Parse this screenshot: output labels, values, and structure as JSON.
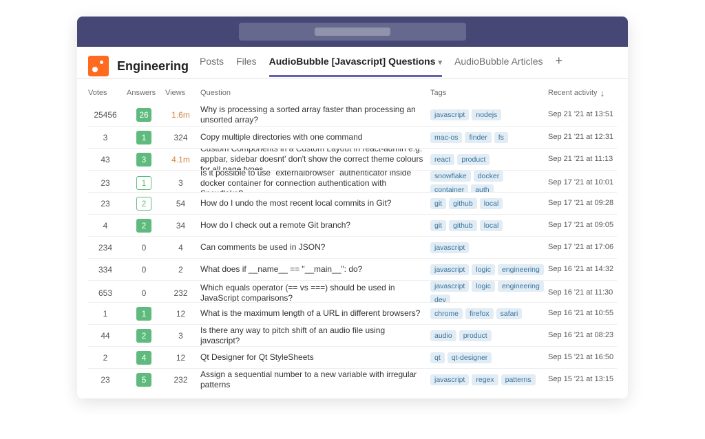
{
  "teamName": "Engineering",
  "tabs": [
    {
      "label": "Posts",
      "active": false,
      "key": "posts"
    },
    {
      "label": "Files",
      "active": false,
      "key": "files"
    },
    {
      "label": "AudioBubble [Javascript] Questions",
      "active": true,
      "hasChevron": true,
      "key": "questions"
    },
    {
      "label": "AudioBubble Articles",
      "active": false,
      "key": "articles"
    }
  ],
  "columns": {
    "votes": "Votes",
    "answers": "Answers",
    "views": "Views",
    "question": "Question",
    "tags": "Tags",
    "activity": "Recent activity"
  },
  "rows": [
    {
      "votes": "25456",
      "answers": "26",
      "answerStyle": "filled",
      "views": "1.6m",
      "viewsBig": true,
      "question": "Why is processing a sorted array faster than processing an unsorted array?",
      "tags": [
        "javascript",
        "nodejs"
      ],
      "activity": "Sep 21 '21 at 13:51"
    },
    {
      "votes": "3",
      "answers": "1",
      "answerStyle": "filled",
      "views": "324",
      "viewsBig": false,
      "question": "Copy multiple directories with one command",
      "tags": [
        "mac-os",
        "finder",
        "fs"
      ],
      "activity": "Sep 21 '21 at 12:31"
    },
    {
      "votes": "43",
      "answers": "3",
      "answerStyle": "filled",
      "views": "4.1m",
      "viewsBig": true,
      "question": "Custom Components in a Custom Layout in react-admin e.g. appbar, sidebar doesnt' don't show the correct theme colours for all page types",
      "tags": [
        "react",
        "product"
      ],
      "activity": "Sep 21 '21 at 11:13"
    },
    {
      "votes": "23",
      "answers": "1",
      "answerStyle": "outlined",
      "views": "3",
      "viewsBig": false,
      "question": "Is it possible to use `externalbrowser` authenticator inside docker container for connection authentication with Snowflake?",
      "tags": [
        "snowflake",
        "docker",
        "container",
        "auth"
      ],
      "activity": "Sep 17 '21 at 10:01"
    },
    {
      "votes": "23",
      "answers": "2",
      "answerStyle": "outlined",
      "views": "54",
      "viewsBig": false,
      "question": "How do I undo the most recent local commits in Git?",
      "tags": [
        "git",
        "github",
        "local"
      ],
      "activity": "Sep 17 '21 at 09:28"
    },
    {
      "votes": "4",
      "answers": "2",
      "answerStyle": "filled",
      "views": "34",
      "viewsBig": false,
      "question": "How do I check out a remote Git branch?",
      "tags": [
        "git",
        "github",
        "local"
      ],
      "activity": "Sep 17 '21 at 09:05"
    },
    {
      "votes": "234",
      "answers": "0",
      "answerStyle": "plain",
      "views": "4",
      "viewsBig": false,
      "question": "Can comments be used in JSON?",
      "tags": [
        "javascript"
      ],
      "activity": "Sep 17 '21 at 17:06"
    },
    {
      "votes": "334",
      "answers": "0",
      "answerStyle": "plain",
      "views": "2",
      "viewsBig": false,
      "question": "What does if __name__ == \"__main__\": do?",
      "tags": [
        "javascript",
        "logic",
        "engineering"
      ],
      "activity": "Sep 16 '21 at 14:32"
    },
    {
      "votes": "653",
      "answers": "0",
      "answerStyle": "plain",
      "views": "232",
      "viewsBig": false,
      "question": "Which equals operator (== vs ===) should be used in JavaScript comparisons?",
      "tags": [
        "javascript",
        "logic",
        "engineering",
        "dev"
      ],
      "activity": "Sep 16 '21 at 11:30"
    },
    {
      "votes": "1",
      "answers": "1",
      "answerStyle": "filled",
      "views": "12",
      "viewsBig": false,
      "question": "What is the maximum length of a URL in different browsers?",
      "tags": [
        "chrome",
        "firefox",
        "safari"
      ],
      "activity": "Sep 16 '21 at 10:55"
    },
    {
      "votes": "44",
      "answers": "2",
      "answerStyle": "filled",
      "views": "3",
      "viewsBig": false,
      "question": "Is there any way to pitch shift of an audio file using javascript?",
      "tags": [
        "audio",
        "product"
      ],
      "activity": "Sep 16 '21 at 08:23"
    },
    {
      "votes": "2",
      "answers": "4",
      "answerStyle": "filled",
      "views": "12",
      "viewsBig": false,
      "question": "Qt Designer for Qt StyleSheets",
      "tags": [
        "qt",
        "qt-designer"
      ],
      "activity": "Sep 15 '21 at 16:50"
    },
    {
      "votes": "23",
      "answers": "5",
      "answerStyle": "filled",
      "views": "232",
      "viewsBig": false,
      "question": "Assign a sequential number to a new variable with irregular patterns",
      "tags": [
        "javascript",
        "regex",
        "patterns"
      ],
      "activity": "Sep 15 '21 at 13:15"
    }
  ]
}
